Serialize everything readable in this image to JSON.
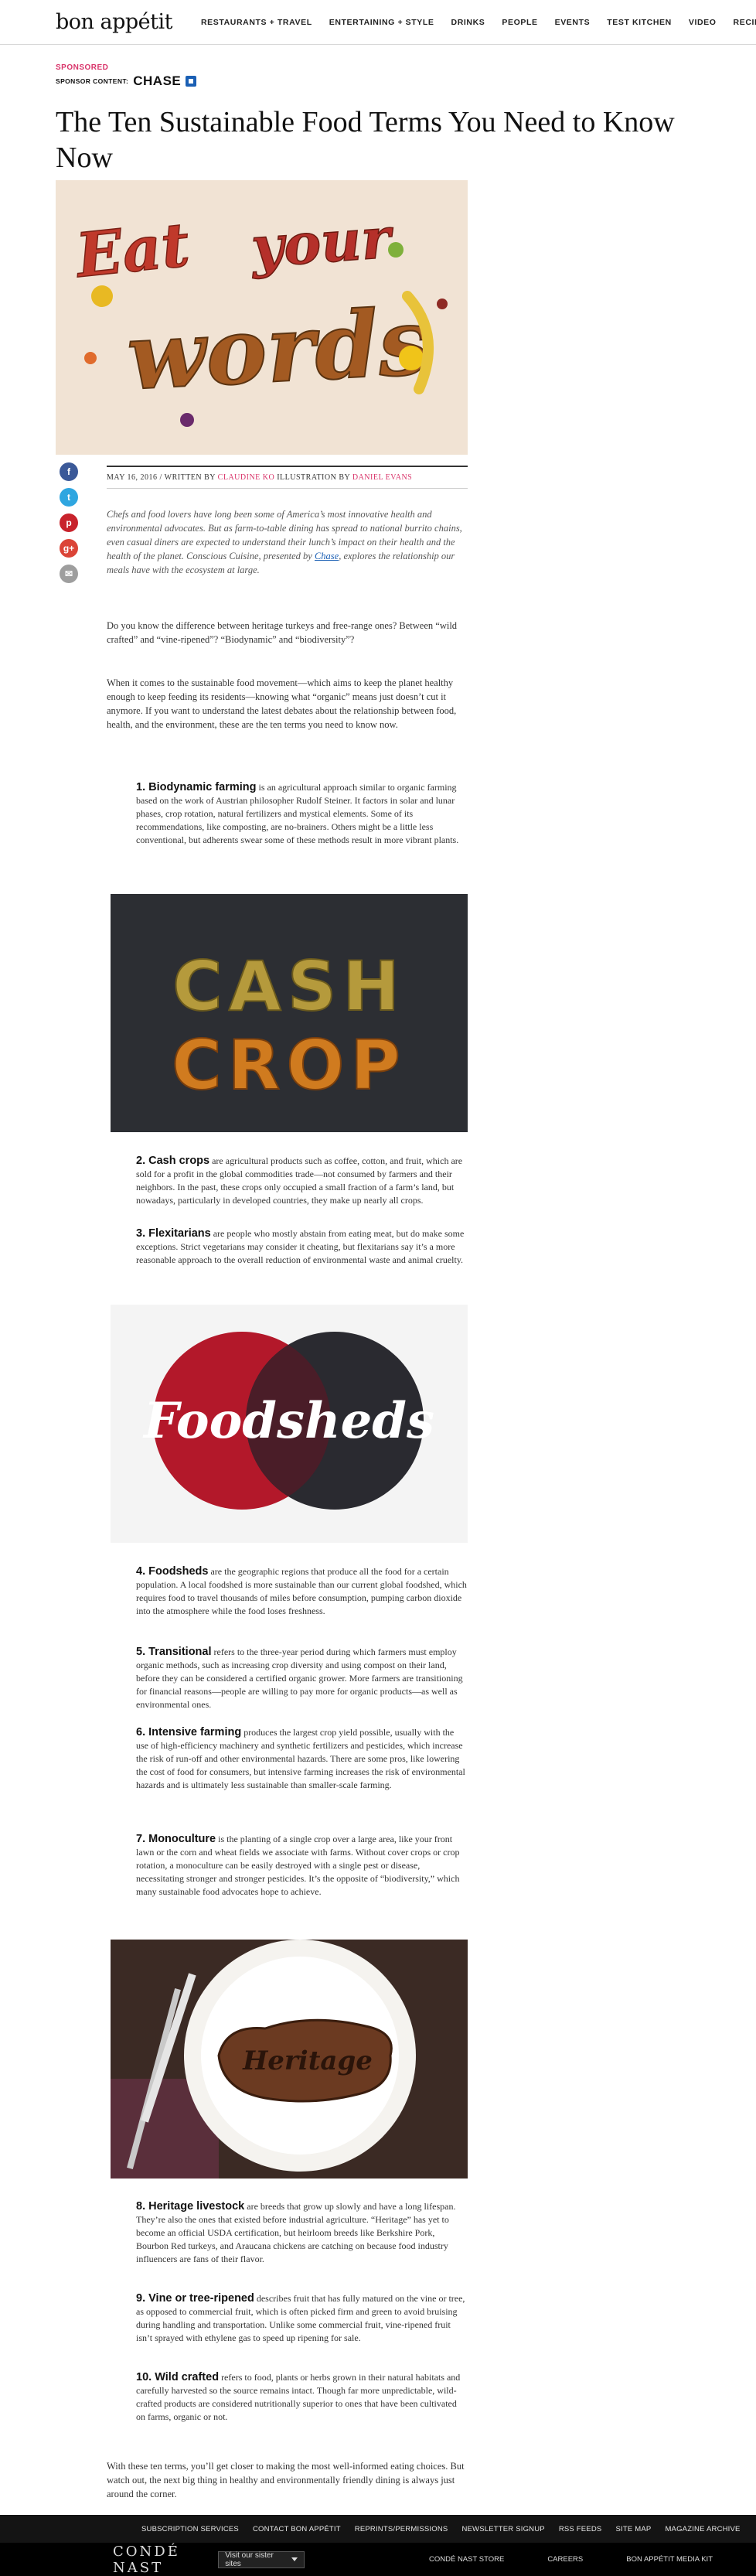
{
  "nav": {
    "logo": "bon appétit",
    "links": [
      "RESTAURANTS + TRAVEL",
      "ENTERTAINING + STYLE",
      "DRINKS",
      "PEOPLE",
      "EVENTS",
      "TEST KITCHEN",
      "VIDEO",
      "RECIPES"
    ],
    "search_icon": "search-icon"
  },
  "sponsor": {
    "tag": "SPONSORED",
    "content_label": "SPONSOR CONTENT",
    "brand": "CHASE"
  },
  "article": {
    "title": "The Ten Sustainable Food Terms You Need to Know Now",
    "hero_text": "Eat your words",
    "meta": {
      "date": "MAY 16, 2016",
      "written_by_label": "WRITTEN BY",
      "author": "CLAUDINE KO",
      "illustration_label": "ILLUSTRATION BY",
      "illustrator": "DANIEL EVANS"
    },
    "intro_before": "Chefs and food lovers have long been some of America’s most innovative health and environmental advocates. But as farm-to-table dining has spread to national burrito chains, even casual diners are expected to understand their lunch’s impact on their health and the health of the planet. Conscious Cuisine, presented by ",
    "intro_link": "Chase",
    "intro_after": ", explores the relationship our meals have with the ecosystem at large.",
    "p1": "Do you know the difference between heritage turkeys and free-range ones? Between “wild crafted” and “vine-ripened”? “Biodynamic” and “biodiversity”?",
    "p2": "When it comes to the sustainable food movement—which aims to keep the planet healthy enough to keep feeding its residents—knowing what “organic” means just doesn’t cut it anymore. If you want to understand the latest debates about the relationship between food, health, and the environment, these are the ten terms you need to know now.",
    "terms": [
      {
        "num": "1.",
        "term": "Biodynamic farming",
        "desc": "is an agricultural approach similar to organic farming based on the work of Austrian philosopher Rudolf Steiner. It factors in solar and lunar phases, crop rotation, natural fertilizers and mystical elements. Some of its recommendations, like composting, are no-brainers. Others might be a little less conventional, but adherents swear some of these methods result in more vibrant plants."
      },
      {
        "num": "2.",
        "term": "Cash crops",
        "desc": "are agricultural products such as coffee, cotton, and fruit, which are sold for a profit in the global commodities trade—not consumed by farmers and their neighbors. In the past, these crops only occupied a small fraction of a farm’s land, but nowadays, particularly in developed countries, they make up nearly all crops."
      },
      {
        "num": "3.",
        "term": "Flexitarians",
        "desc": "are people who mostly abstain from eating meat, but do make some exceptions. Strict vegetarians may consider it cheating, but flexitarians say it’s a more reasonable approach to the overall reduction of environmental waste and animal cruelty."
      },
      {
        "num": "4.",
        "term": "Foodsheds",
        "desc": "are the geographic regions that produce all the food for a certain population. A local foodshed is more sustainable than our current global foodshed, which requires food to travel thousands of miles before consumption, pumping carbon dioxide into the atmosphere while the food loses freshness."
      },
      {
        "num": "5.",
        "term": "Transitional",
        "desc": "refers to the three-year period during which farmers must employ organic methods, such as increasing crop diversity and using compost on their land, before they can be considered a certified organic grower. More farmers are transitioning for financial reasons—people are willing to pay more for organic products—as well as environmental ones."
      },
      {
        "num": "6.",
        "term": "Intensive farming",
        "desc": "produces the largest crop yield possible, usually with the use of high-efficiency machinery and synthetic fertilizers and pesticides, which increase the risk of run-off and other environmental hazards. There are some pros, like lowering the cost of food for consumers, but intensive farming increases the risk of environmental hazards and is ultimately less sustainable than smaller-scale farming."
      },
      {
        "num": "7.",
        "term": "Monoculture",
        "desc": "is the planting of a single crop over a large area, like your front lawn or the corn and wheat fields we associate with farms. Without cover crops or crop rotation, a monoculture can be easily destroyed with a single pest or disease, necessitating stronger and stronger pesticides. It’s the opposite of “biodiversity,” which many sustainable food advocates hope to achieve."
      },
      {
        "num": "8.",
        "term": "Heritage livestock",
        "desc": "are breeds that grow up slowly and have a long lifespan. They’re also the ones that existed before industrial agriculture. “Heritage” has yet to become an official USDA certification, but heirloom breeds like Berkshire Pork, Bourbon Red turkeys, and Araucana chickens are catching on because food industry influencers are fans of their flavor."
      },
      {
        "num": "9.",
        "term": "Vine or tree-ripened",
        "desc": "describes fruit that has fully matured on the vine or tree, as opposed to commercial fruit, which is often picked firm and green to avoid bruising during handling and transportation. Unlike some commercial fruit, vine-ripened fruit isn’t sprayed with ethylene gas to speed up ripening for sale."
      },
      {
        "num": "10.",
        "term": "Wild crafted",
        "desc": "refers to food, plants or herbs grown in their natural habitats and carefully harvested so the source remains intact. Though far more unpredictable, wild-crafted products are considered nutritionally superior to ones that have been cultivated on farms, organic or not."
      }
    ],
    "images": {
      "cash_crop_line1": "CASH",
      "cash_crop_line2": "CROP",
      "foodsheds": "Foodsheds",
      "heritage": "Heritage"
    },
    "closing": "With these ten terms, you’ll get closer to making the most well-informed eating choices. But watch out, the next big thing in healthy and environmentally friendly dining is always just around the corner."
  },
  "social": {
    "facebook": "f",
    "twitter": "t",
    "pinterest": "p",
    "googleplus": "g+",
    "email": "✉"
  },
  "footer": {
    "links": [
      "SUBSCRIPTION SERVICES",
      "CONTACT BON APPÉTIT",
      "REPRINTS/PERMISSIONS",
      "NEWSLETTER SIGNUP",
      "RSS FEEDS",
      "SITE MAP",
      "MAGAZINE ARCHIVE"
    ],
    "brand": "CONDÉ NAST",
    "sister_select": "Visit our sister sites",
    "bottom_links": [
      "CONDÉ NAST STORE",
      "CAREERS",
      "BON APPÉTIT MEDIA KIT"
    ]
  },
  "colors": {
    "accent_pink": "#d9346a",
    "link_blue": "#1a5fb4",
    "footer_dark": "#141414"
  }
}
